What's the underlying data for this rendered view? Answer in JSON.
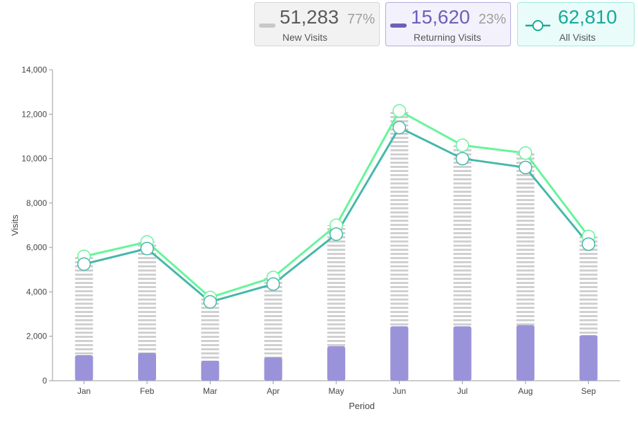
{
  "summary": {
    "new_visits": {
      "value": "51,283",
      "percent": "77%",
      "label": "New Visits",
      "color": "#c8c8c8"
    },
    "returning_visits": {
      "value": "15,620",
      "percent": "23%",
      "label": "Returning Visits",
      "color": "#6f5eb8"
    },
    "all_visits": {
      "value": "62,810",
      "label": "All Visits",
      "color": "#17a99a",
      "icon": "line-marker-icon"
    }
  },
  "chart_data": {
    "type": "bar",
    "categories": [
      "Jan",
      "Feb",
      "Mar",
      "Apr",
      "May",
      "Jun",
      "Jul",
      "Aug",
      "Sep"
    ],
    "series": [
      {
        "name": "New Visits",
        "type": "bar",
        "values": [
          5600,
          6250,
          3750,
          4650,
          7000,
          12150,
          10600,
          10250,
          6500
        ],
        "color": "#d0d0d0",
        "pattern": "horizontal-stripes"
      },
      {
        "name": "Returning Visits",
        "type": "bar",
        "values": [
          1150,
          1250,
          900,
          1050,
          1550,
          2450,
          2450,
          2500,
          2050
        ],
        "color": "#9b93d9"
      },
      {
        "name": "All Visits",
        "type": "line",
        "values": [
          5250,
          5950,
          3550,
          4350,
          6600,
          11400,
          10000,
          9600,
          6150
        ],
        "color": "#45b8a8"
      },
      {
        "type": "line",
        "values": [
          5600,
          6250,
          3750,
          4650,
          7000,
          12150,
          10600,
          10250,
          6500
        ],
        "color": "#66f59a"
      }
    ],
    "xlabel": "Period",
    "ylabel": "Visits",
    "ylim": [
      0,
      14000
    ],
    "yticks": [
      0,
      2000,
      4000,
      6000,
      8000,
      10000,
      12000,
      14000
    ],
    "ytick_labels": [
      "0",
      "2,000",
      "4,000",
      "6,000",
      "8,000",
      "10,000",
      "12,000",
      "14,000"
    ],
    "grid": false,
    "legend": "top-right"
  }
}
